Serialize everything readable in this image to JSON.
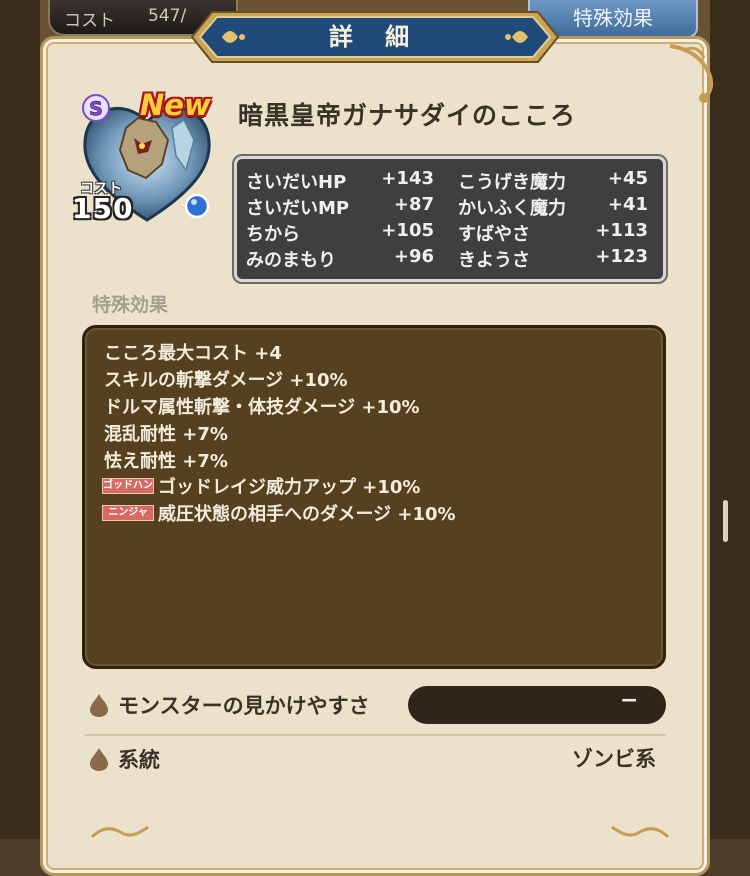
{
  "top_bar": {
    "cost_label": "コスト",
    "cost_value": "547/",
    "tab_label": "特殊効果"
  },
  "dialog": {
    "title": "詳 細"
  },
  "heart": {
    "rank": "S",
    "new_label": "New",
    "cost_label": "コスト",
    "cost_value": "150",
    "name": "暗黒皇帝ガナサダイのこころ",
    "gem_color": "#2f6fd6"
  },
  "stats": [
    {
      "label": "さいだいHP",
      "value": "+143"
    },
    {
      "label": "さいだいMP",
      "value": "+87"
    },
    {
      "label": "ちから",
      "value": "+105"
    },
    {
      "label": "みのまもり",
      "value": "+96"
    },
    {
      "label": "こうげき魔力",
      "value": "+45"
    },
    {
      "label": "かいふく魔力",
      "value": "+41"
    },
    {
      "label": "すばやさ",
      "value": "+113"
    },
    {
      "label": "きようさ",
      "value": "+123"
    }
  ],
  "special": {
    "label": "特殊効果",
    "effects": [
      "こころ最大コスト +4",
      "スキルの斬撃ダメージ +10%",
      "ドルマ属性斬撃・体技ダメージ +10%",
      "混乱耐性 +7%",
      "怯え耐性 +7%"
    ],
    "job_effects": [
      {
        "tag": "ゴッドハン",
        "text": "ゴッドレイジ威力アップ +10%"
      },
      {
        "tag": "ニンジャ",
        "text": "威圧状態の相手へのダメージ +10%"
      }
    ]
  },
  "rows": {
    "visibility_label": "モンスターの見かけやすさ",
    "visibility_value": "−",
    "lineage_label": "系統",
    "lineage_value": "ゾンビ系"
  }
}
